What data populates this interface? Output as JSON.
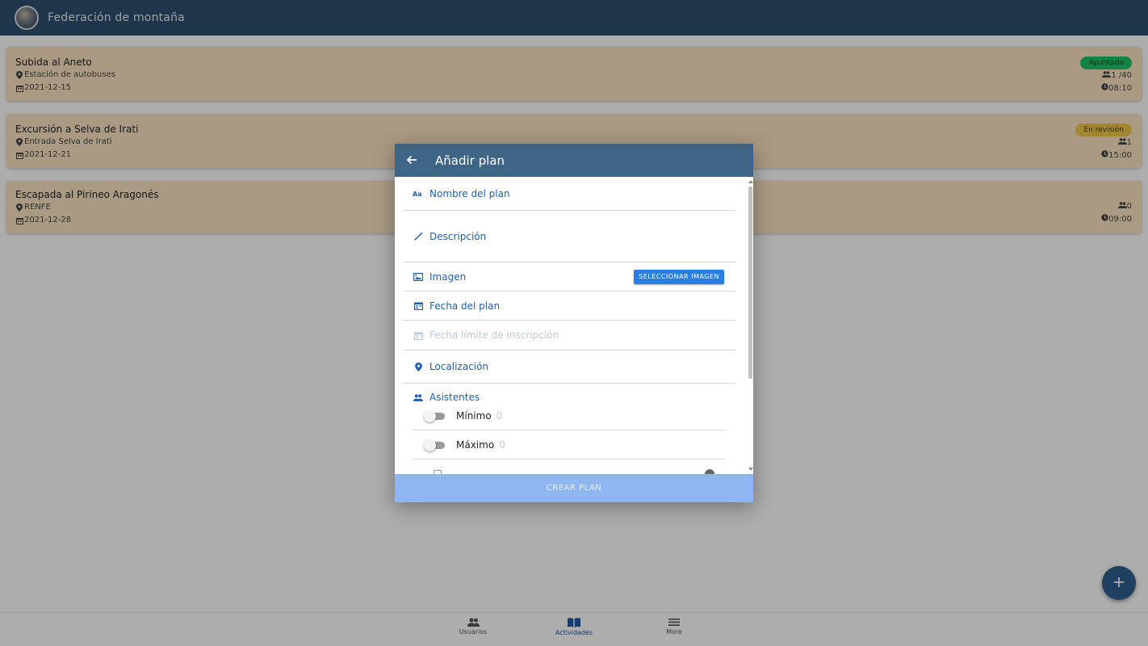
{
  "app": {
    "title": "Federación de montaña"
  },
  "activities": [
    {
      "title": "Subida al Aneto",
      "location": "Estación de autobuses",
      "date": "2021-12-15",
      "badge": "Apuntado",
      "badge_color": "#1ec26a",
      "attendees": "1 /40",
      "time": "08:10"
    },
    {
      "title": "Excursión a Selva de Irati",
      "location": "Entrada Selva de Irati",
      "date": "2021-12-21",
      "badge": "En revisión",
      "badge_color": "#f0c64a",
      "attendees": "1",
      "time": "15:00"
    },
    {
      "title": "Escapada al Pirineo Aragonés",
      "location": "RENFE",
      "date": "2021-12-28",
      "badge": "",
      "attendees": "0",
      "time": "09:00"
    }
  ],
  "bottom_nav": [
    {
      "label": "Usuarios",
      "icon": "people-icon"
    },
    {
      "label": "Actividades",
      "icon": "book-icon",
      "active": true
    },
    {
      "label": "More",
      "icon": "menu-icon"
    }
  ],
  "fab": {
    "icon": "plus-icon"
  },
  "dialog": {
    "title": "Añadir plan",
    "fields": {
      "name": "Nombre del plan",
      "description": "Descripción",
      "image": "Imagen",
      "image_button": "SELECCIONAR IMAGEN",
      "date": "Fecha del plan",
      "deadline": "Fecha límite de inscripción",
      "location": "Localización",
      "attendees": "Asistentes"
    },
    "attendees": {
      "min_label": "Mínimo",
      "min_value": "0",
      "max_label": "Máximo",
      "max_value": "0"
    },
    "submit": "CREAR PLAN"
  },
  "colors": {
    "app_bar": "#2f4f6f",
    "card": "#fbe4c2",
    "dialog_header": "#3e6486",
    "accent": "#1f5fb0",
    "submit_disabled": "#8fb6f0"
  }
}
